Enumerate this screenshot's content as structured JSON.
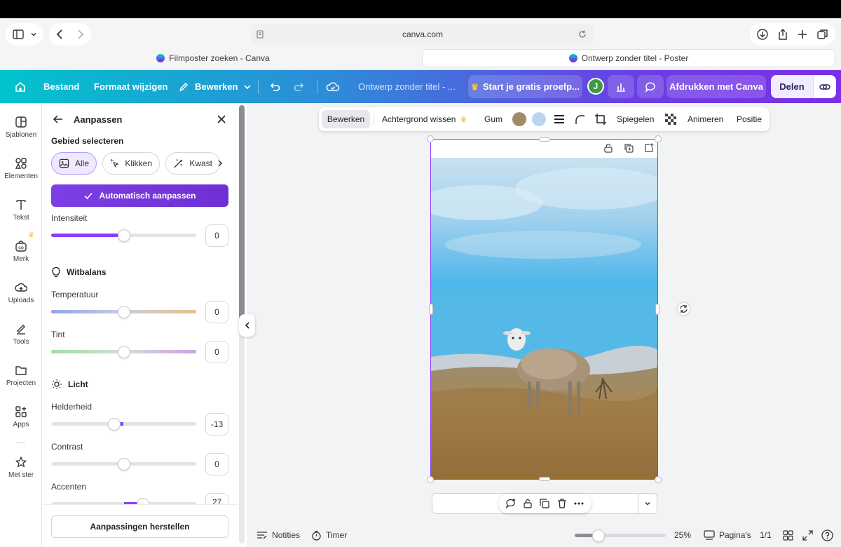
{
  "browser": {
    "address": "canva.com",
    "tabs": [
      {
        "label": "Filmposter zoeken - Canva"
      },
      {
        "label": "Ontwerp zonder titel - Poster"
      }
    ]
  },
  "header": {
    "file": "Bestand",
    "resize": "Formaat wijzigen",
    "edit": "Bewerken",
    "doc_title": "Ontwerp zonder titel - ...",
    "trial": "Start je gratis proefp...",
    "avatar_letter": "J",
    "print": "Afdrukken met Canva",
    "share": "Delen"
  },
  "rail": [
    {
      "label": "Sjablonen",
      "icon": "templates-icon"
    },
    {
      "label": "Elementen",
      "icon": "elements-icon"
    },
    {
      "label": "Tekst",
      "icon": "text-icon"
    },
    {
      "label": "Merk",
      "icon": "brand-icon"
    },
    {
      "label": "Uploads",
      "icon": "upload-icon"
    },
    {
      "label": "Tools",
      "icon": "tools-icon"
    },
    {
      "label": "Projecten",
      "icon": "folder-icon"
    },
    {
      "label": "Apps",
      "icon": "apps-icon"
    },
    {
      "label": "Met ster",
      "icon": "star-icon"
    }
  ],
  "panel": {
    "title": "Aanpassen",
    "select_area": "Gebied selecteren",
    "chips": [
      "Alle",
      "Klikken",
      "Kwast"
    ],
    "auto_adjust": "Automatisch aanpassen",
    "intensity": {
      "label": "Intensiteit",
      "value": "0",
      "level": 0.5
    },
    "white_balance": "Witbalans",
    "temperature": {
      "label": "Temperatuur",
      "value": "0",
      "level": 0.5
    },
    "tint": {
      "label": "Tint",
      "value": "0",
      "level": 0.5
    },
    "light": "Licht",
    "brightness": {
      "label": "Helderheid",
      "value": "-13",
      "level": 0.435
    },
    "contrast": {
      "label": "Contrast",
      "value": "0",
      "level": 0.5
    },
    "accents": {
      "label": "Accenten",
      "value": "27",
      "level": 0.635
    },
    "reset": "Aanpassingen herstellen"
  },
  "context_toolbar": {
    "edit": "Bewerken",
    "bg_remove": "Achtergrond wissen",
    "eraser": "Gum",
    "swatch1": "#a58a6a",
    "swatch2": "#b9d6f0",
    "mirror": "Spiegelen",
    "animate": "Animeren",
    "position": "Positie"
  },
  "status_bar": {
    "notes": "Notities",
    "timer": "Timer",
    "zoom": "25%",
    "pages": "Pagina's",
    "page_count": "1/1"
  },
  "colors": {
    "accent": "#8b3dff",
    "brand_teal": "#01c3cd"
  }
}
